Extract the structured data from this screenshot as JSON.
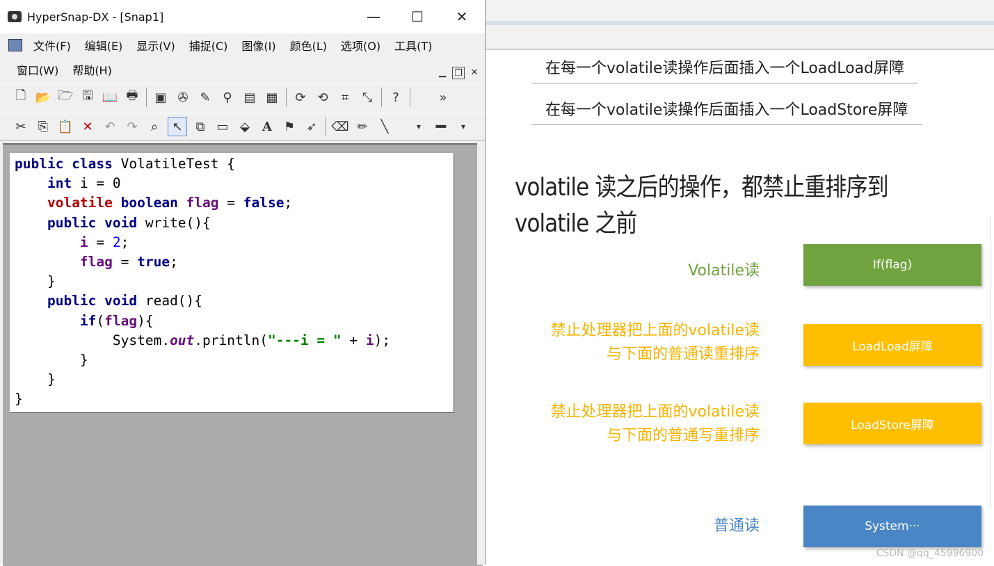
{
  "window": {
    "title": "HyperSnap-DX - [Snap1]",
    "minimize": "—",
    "maximize": "☐",
    "close": "✕"
  },
  "menu": {
    "row1": [
      "文件(F)",
      "编辑(E)",
      "显示(V)",
      "捕捉(C)",
      "图像(I)",
      "颜色(L)",
      "选项(O)",
      "工具(T)"
    ],
    "row2": [
      "窗口(W)",
      "帮助(H)"
    ]
  },
  "code_lines": [
    "public class VolatileTest {",
    "    int i = 0;",
    "    volatile boolean flag = false;",
    "    public void write(){",
    "        i = 2;",
    "        flag = true;",
    "    }",
    "    public void read(){",
    "        if(flag){",
    "            System.out.println(\"---i = \" + i);",
    "        }",
    "    }",
    "}"
  ],
  "slide": {
    "line1": "在每一个volatile读操作后面插入一个LoadLoad屏障",
    "line2": "在每一个volatile读操作后面插入一个LoadStore屏障",
    "title": "volatile 读之后的操作，都禁止重排序到 volatile 之前",
    "label_volatile_read": "Volatile读",
    "label_forbid1_a": "禁止处理器把上面的volatile读",
    "label_forbid1_b": "与下面的普通读重排序",
    "label_forbid2_a": "禁止处理器把上面的volatile读",
    "label_forbid2_b": "与下面的普通写重排序",
    "label_normal_read": "普通读",
    "block_if": "If(flag)",
    "block_loadload": "LoadLoad屏障",
    "block_loadstore": "LoadStore屏障",
    "block_system": "System···",
    "watermark": "CSDN @qq_45996900"
  },
  "colors": {
    "green": "#70a33f",
    "orange": "#ffbf00",
    "blue": "#4a86c5",
    "label_orange": "#f5b400",
    "label_blue": "#4a86c5",
    "label_green": "#70a33f"
  }
}
